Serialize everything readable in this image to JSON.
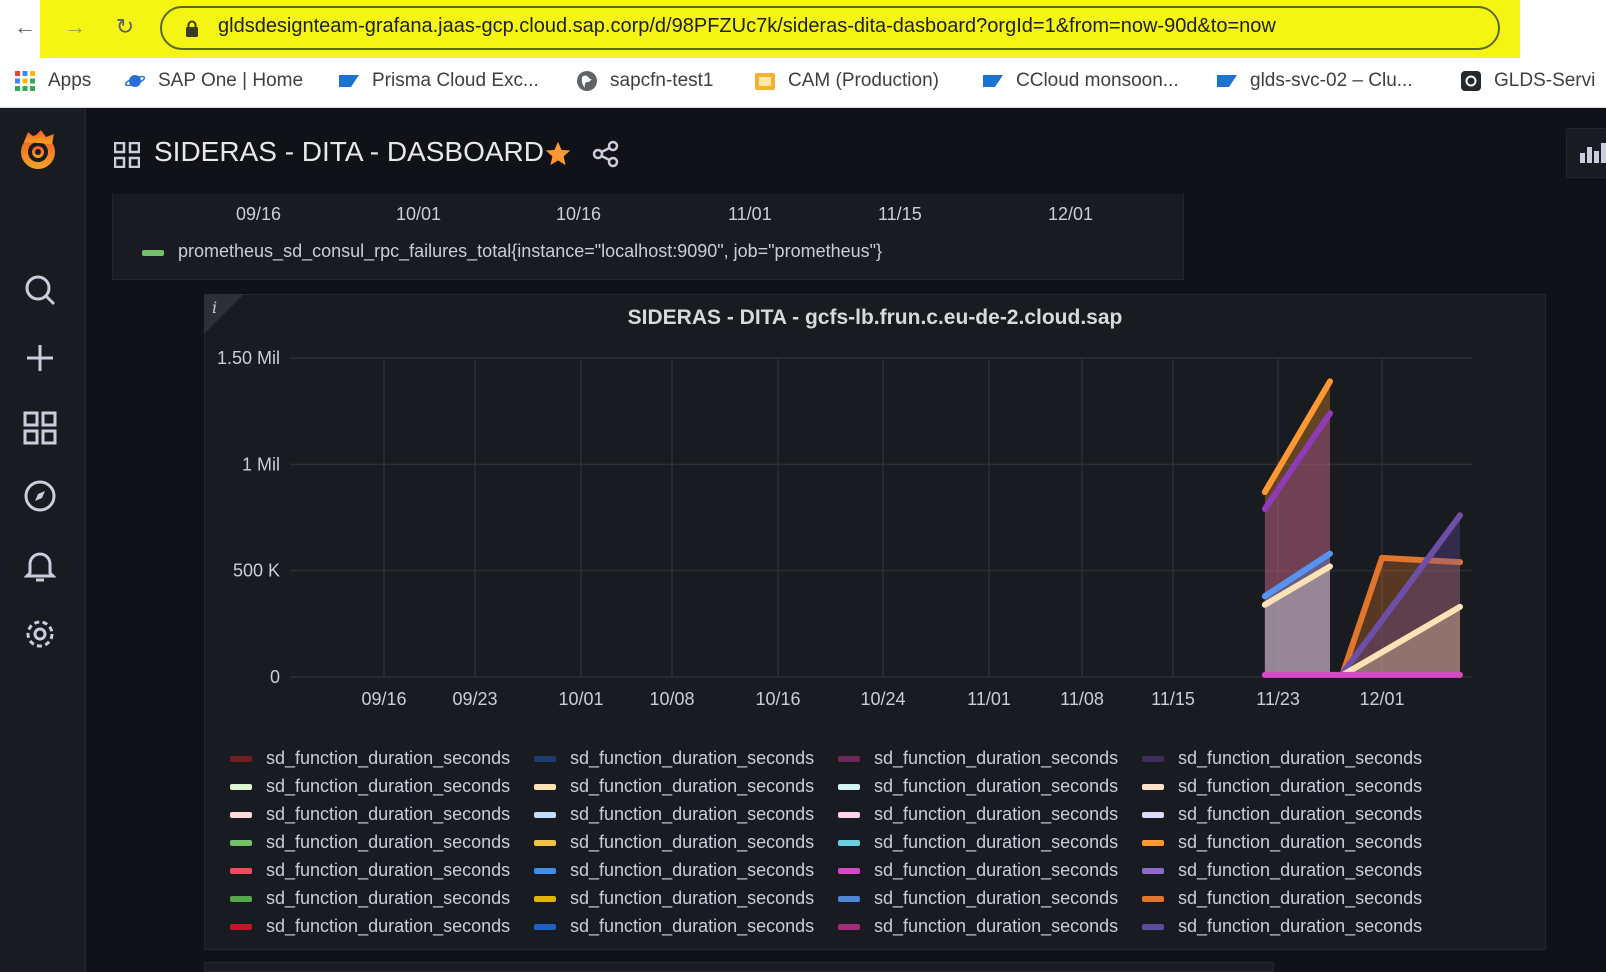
{
  "browser": {
    "url": "gldsdesignteam-grafana.jaas-gcp.cloud.sap.corp/d/98PFZUc7k/sideras-dita-dasboard?orgId=1&from=now-90d&to=now",
    "bookmarks": [
      {
        "label": "Apps",
        "icon": "apps-grid-icon"
      },
      {
        "label": "SAP One | Home",
        "icon": "saturn-icon"
      },
      {
        "label": "Prisma Cloud Exc...",
        "icon": "sap-logo-icon"
      },
      {
        "label": "sapcfn-test1",
        "icon": "globe-icon"
      },
      {
        "label": "CAM (Production)",
        "icon": "cam-icon"
      },
      {
        "label": "CCloud monsoon...",
        "icon": "sap-logo-icon"
      },
      {
        "label": "glds-svc-02 – Clu...",
        "icon": "sap-logo-icon"
      },
      {
        "label": "GLDS-Servi",
        "icon": "github-icon"
      }
    ]
  },
  "dashboard": {
    "title": "SIDERAS - DITA - DASBOARD",
    "accent_star": "#ff9830"
  },
  "top_panel": {
    "x_ticks": [
      "09/16",
      "10/01",
      "10/16",
      "11/01",
      "11/15",
      "12/01"
    ],
    "legend": {
      "label": "prometheus_sd_consul_rpc_failures_total{instance=\"localhost:9090\", job=\"prometheus\"}",
      "color": "#73bf69"
    }
  },
  "chart_data": {
    "type": "area",
    "title": "SIDERAS - DITA - gcfs-lb.frun.c.eu-de-2.cloud.sap",
    "xlabel": "",
    "ylabel": "",
    "y_ticks": [
      "0",
      "500 K",
      "1 Mil",
      "1.50 Mil"
    ],
    "y_tick_values": [
      0,
      500000,
      1000000,
      1500000
    ],
    "ylim": [
      0,
      1500000
    ],
    "x_ticks": [
      "09/16",
      "09/23",
      "10/01",
      "10/08",
      "10/16",
      "10/24",
      "11/01",
      "11/08",
      "11/15",
      "11/23",
      "12/01"
    ],
    "grid": true,
    "series": [
      {
        "color": "#ff9830",
        "points": [
          [
            "11/22",
            870000
          ],
          [
            "11/27",
            1390000
          ]
        ]
      },
      {
        "color": "#8f3bb8",
        "points": [
          [
            "11/22",
            790000
          ],
          [
            "11/27",
            1240000
          ]
        ]
      },
      {
        "color": "#5794f2",
        "points": [
          [
            "11/22",
            380000
          ],
          [
            "11/27",
            580000
          ]
        ]
      },
      {
        "color": "#fce2b4",
        "points": [
          [
            "11/22",
            340000
          ],
          [
            "11/27",
            520000
          ]
        ]
      },
      {
        "color": "#e0752d",
        "points": [
          [
            "11/28",
            20000
          ],
          [
            "12/01",
            560000
          ],
          [
            "12/07",
            540000
          ]
        ]
      },
      {
        "color": "#6e4fa8",
        "points": [
          [
            "11/28",
            20000
          ],
          [
            "12/07",
            760000
          ]
        ]
      },
      {
        "color": "#fce2b4",
        "points": [
          [
            "11/28",
            10000
          ],
          [
            "12/07",
            330000
          ]
        ]
      },
      {
        "color": "#d44ac3",
        "points": [
          [
            "11/22",
            10000
          ],
          [
            "12/07",
            10000
          ]
        ]
      }
    ],
    "legend": {
      "placement": "bottom",
      "label": "sd_function_duration_seconds",
      "colors": [
        "#6e2020",
        "#1f3c6e",
        "#6b2a5a",
        "#3d2d5c",
        "#e0f5d5",
        "#fce2b4",
        "#d5f5f5",
        "#fce2c8",
        "#ffd8dc",
        "#c0def5",
        "#ffd0ef",
        "#e0d8ff",
        "#73bf69",
        "#f2c14a",
        "#6ccfe0",
        "#ff9830",
        "#f2495c",
        "#3f8fe8",
        "#d44ac3",
        "#8f6ac8",
        "#56a64b",
        "#e0b400",
        "#4f86d8",
        "#e0752d",
        "#c4162a",
        "#1f60c4",
        "#a02f7a",
        "#5e4c9c"
      ]
    }
  }
}
